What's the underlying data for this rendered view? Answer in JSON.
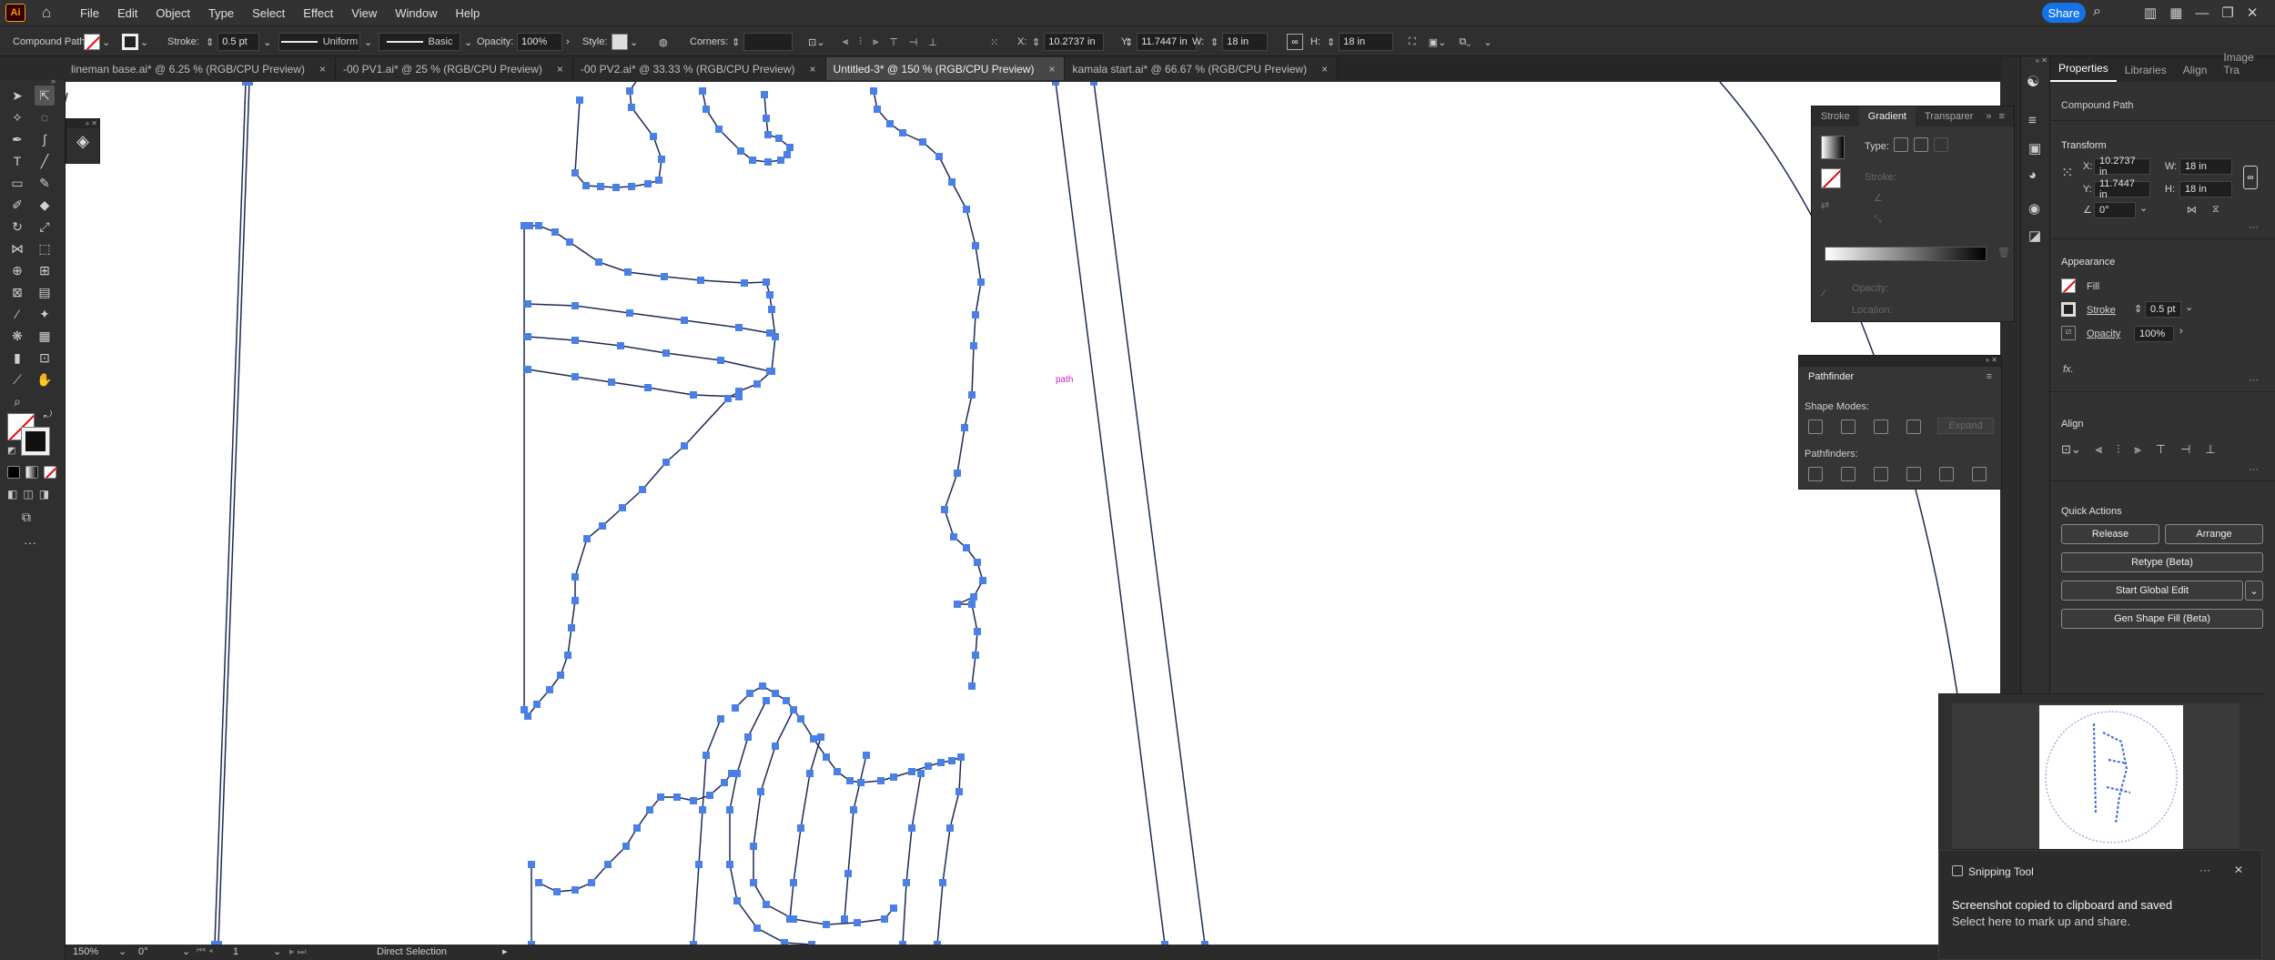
{
  "app": {
    "logo": "Ai"
  },
  "menu": [
    "File",
    "Edit",
    "Object",
    "Type",
    "Select",
    "Effect",
    "View",
    "Window",
    "Help"
  ],
  "share_label": "Share",
  "control": {
    "object_type": "Compound Path",
    "stroke_label": "Stroke:",
    "stroke_value": "0.5 pt",
    "profile": "Uniform",
    "brush": "Basic",
    "opacity_label": "Opacity:",
    "opacity_value": "100%",
    "style_label": "Style:",
    "corners_label": "Corners:",
    "x_label": "X:",
    "x_value": "10.2737 in",
    "y_label": "Y:",
    "y_value": "11.7447 in",
    "w_label": "W:",
    "w_value": "18 in",
    "h_label": "H:",
    "h_value": "18 in"
  },
  "tabs": [
    {
      "label": "lineman base.ai* @ 6.25 % (RGB/CPU Preview)"
    },
    {
      "label": "-00 PV1.ai* @ 25 % (RGB/CPU Preview)"
    },
    {
      "label": "-00 PV2.ai* @ 33.33 % (RGB/CPU Preview)"
    },
    {
      "label": "Untitled-3* @ 150 % (RGB/CPU Preview)",
      "active": true
    },
    {
      "label": "kamala start.ai* @ 66.67 % (RGB/CPU Preview)"
    }
  ],
  "tab_close": "×",
  "canvas": {
    "hover_label": "path"
  },
  "status": {
    "zoom": "150%",
    "rotation": "0°",
    "page": "1",
    "tool": "Direct Selection"
  },
  "gradient_panel": {
    "tabs": [
      "Stroke",
      "Gradient",
      "Transparer"
    ],
    "type_label": "Type:",
    "stroke_label": "Stroke:",
    "opacity_label": "Opacity:",
    "location_label": "Location:"
  },
  "pathfinder": {
    "title": "Pathfinder",
    "shape_modes": "Shape Modes:",
    "expand": "Expand",
    "pathfinders": "Pathfinders:"
  },
  "properties": {
    "tabs": [
      "Properties",
      "Libraries",
      "Align",
      "Image Tra"
    ],
    "object_type": "Compound Path",
    "transform_title": "Transform",
    "x_label": "X:",
    "x_value": "10.2737 in",
    "y_label": "Y:",
    "y_value": "11.7447 in",
    "w_label": "W:",
    "w_value": "18 in",
    "h_label": "H:",
    "h_value": "18 in",
    "rotate_value": "0°",
    "appearance_title": "Appearance",
    "fill_label": "Fill",
    "stroke_label": "Stroke",
    "stroke_value": "0.5 pt",
    "opacity_label": "Opacity",
    "opacity_value": "100%",
    "fx": "fx.",
    "align_title": "Align",
    "quick_actions_title": "Quick Actions",
    "release": "Release",
    "arrange": "Arrange",
    "retype": "Retype (Beta)",
    "global_edit": "Start Global Edit",
    "gen_shape": "Gen Shape Fill (Beta)"
  },
  "toast": {
    "app": "Snipping Tool",
    "title": "Screenshot copied to clipboard and saved",
    "subtitle": "Select here to mark up and share.",
    "more": "···",
    "close": "✕"
  },
  "colors": {
    "accent": "#1473e6",
    "anchor": "#4a7fe6",
    "path": "#1e2a55",
    "hover": "#d020d0"
  }
}
